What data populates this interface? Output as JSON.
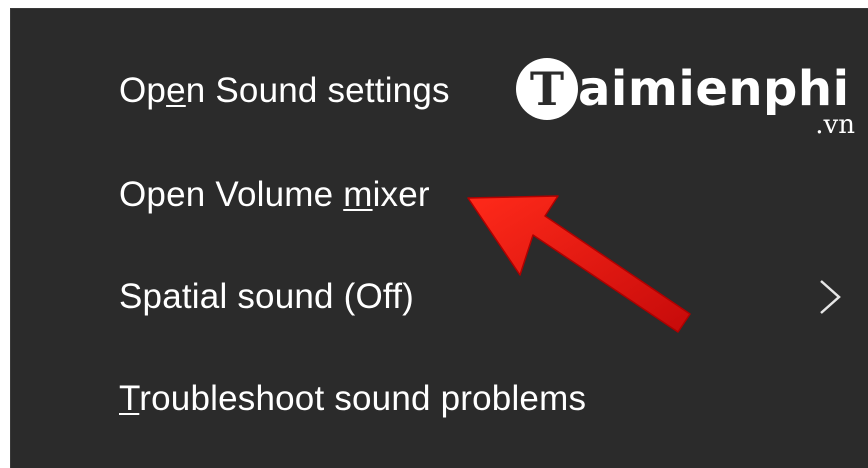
{
  "menu": {
    "items": [
      {
        "pre": "Op",
        "access": "e",
        "post": "n Sound settings"
      },
      {
        "pre": "Open Volume ",
        "access": "m",
        "post": "ixer"
      },
      {
        "pre": "Spatial sound (Off)",
        "access": "",
        "post": ""
      },
      {
        "pre": "",
        "access": "T",
        "post": "roubleshoot sound problems"
      }
    ]
  },
  "watermark": {
    "badge": "T",
    "text": "aimienphi",
    "domain": ".vn"
  },
  "icons": {
    "submenu": "chevron-right-icon",
    "annotation": "red-arrow-icon"
  },
  "colors": {
    "menu_background": "#2b2b2b",
    "text": "#ffffff",
    "arrow": "#e81010"
  }
}
